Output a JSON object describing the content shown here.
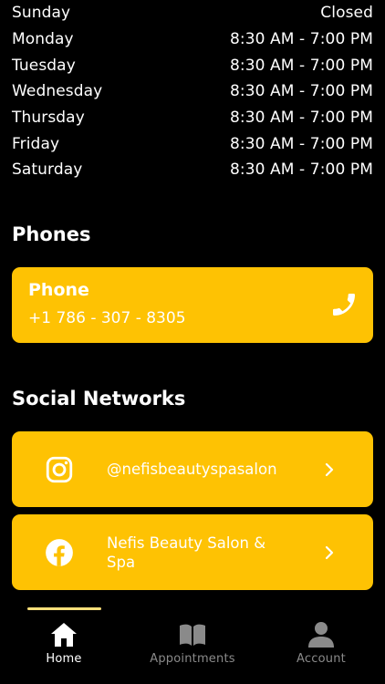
{
  "hours": [
    {
      "day": "Sunday",
      "time": "Closed"
    },
    {
      "day": "Monday",
      "time": "8:30 AM - 7:00 PM"
    },
    {
      "day": "Tuesday",
      "time": "8:30 AM - 7:00 PM"
    },
    {
      "day": "Wednesday",
      "time": "8:30 AM - 7:00 PM"
    },
    {
      "day": "Thursday",
      "time": "8:30 AM - 7:00 PM"
    },
    {
      "day": "Friday",
      "time": "8:30 AM - 7:00 PM"
    },
    {
      "day": "Saturday",
      "time": "8:30 AM - 7:00 PM"
    }
  ],
  "phones": {
    "title": "Phones",
    "card": {
      "label": "Phone",
      "number": "+1 786 - 307 - 8305",
      "icon": "phone-icon"
    }
  },
  "social": {
    "title": "Social Networks",
    "items": [
      {
        "name": "@nefisbeautyspasalon",
        "icon": "instagram-icon"
      },
      {
        "name": "Nefis Beauty Salon & Spa",
        "icon": "facebook-icon"
      }
    ]
  },
  "tabs": [
    {
      "label": "Home",
      "icon": "home-icon",
      "active": true
    },
    {
      "label": "Appointments",
      "icon": "book-icon",
      "active": false
    },
    {
      "label": "Account",
      "icon": "person-icon",
      "active": false
    }
  ],
  "colors": {
    "accent": "#FEC203",
    "background": "#000000",
    "inactive_tab": "#8a8a8a",
    "indicator": "#FEE07A"
  }
}
